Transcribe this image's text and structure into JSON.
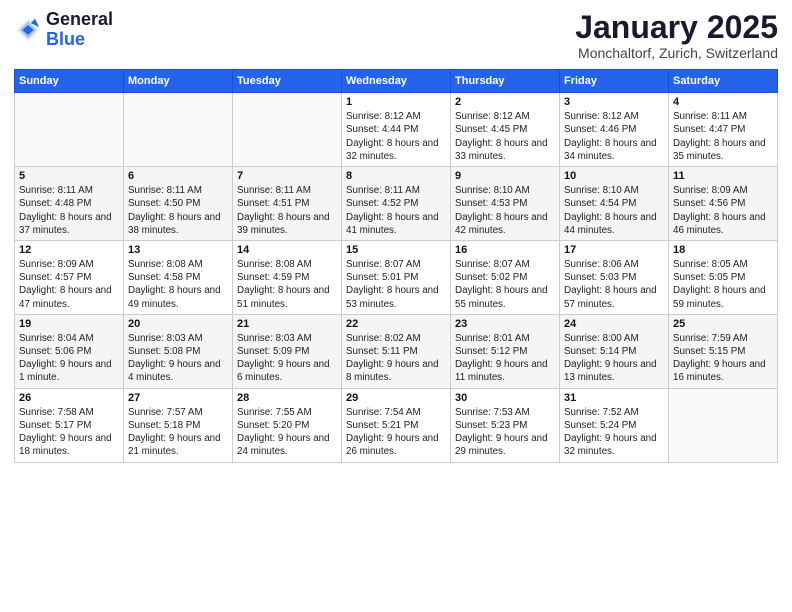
{
  "header": {
    "logo_general": "General",
    "logo_blue": "Blue",
    "month_title": "January 2025",
    "location": "Monchaltorf, Zurich, Switzerland"
  },
  "weekdays": [
    "Sunday",
    "Monday",
    "Tuesday",
    "Wednesday",
    "Thursday",
    "Friday",
    "Saturday"
  ],
  "weeks": [
    [
      {
        "day": "",
        "info": ""
      },
      {
        "day": "",
        "info": ""
      },
      {
        "day": "",
        "info": ""
      },
      {
        "day": "1",
        "info": "Sunrise: 8:12 AM\nSunset: 4:44 PM\nDaylight: 8 hours and 32 minutes."
      },
      {
        "day": "2",
        "info": "Sunrise: 8:12 AM\nSunset: 4:45 PM\nDaylight: 8 hours and 33 minutes."
      },
      {
        "day": "3",
        "info": "Sunrise: 8:12 AM\nSunset: 4:46 PM\nDaylight: 8 hours and 34 minutes."
      },
      {
        "day": "4",
        "info": "Sunrise: 8:11 AM\nSunset: 4:47 PM\nDaylight: 8 hours and 35 minutes."
      }
    ],
    [
      {
        "day": "5",
        "info": "Sunrise: 8:11 AM\nSunset: 4:48 PM\nDaylight: 8 hours and 37 minutes."
      },
      {
        "day": "6",
        "info": "Sunrise: 8:11 AM\nSunset: 4:50 PM\nDaylight: 8 hours and 38 minutes."
      },
      {
        "day": "7",
        "info": "Sunrise: 8:11 AM\nSunset: 4:51 PM\nDaylight: 8 hours and 39 minutes."
      },
      {
        "day": "8",
        "info": "Sunrise: 8:11 AM\nSunset: 4:52 PM\nDaylight: 8 hours and 41 minutes."
      },
      {
        "day": "9",
        "info": "Sunrise: 8:10 AM\nSunset: 4:53 PM\nDaylight: 8 hours and 42 minutes."
      },
      {
        "day": "10",
        "info": "Sunrise: 8:10 AM\nSunset: 4:54 PM\nDaylight: 8 hours and 44 minutes."
      },
      {
        "day": "11",
        "info": "Sunrise: 8:09 AM\nSunset: 4:56 PM\nDaylight: 8 hours and 46 minutes."
      }
    ],
    [
      {
        "day": "12",
        "info": "Sunrise: 8:09 AM\nSunset: 4:57 PM\nDaylight: 8 hours and 47 minutes."
      },
      {
        "day": "13",
        "info": "Sunrise: 8:08 AM\nSunset: 4:58 PM\nDaylight: 8 hours and 49 minutes."
      },
      {
        "day": "14",
        "info": "Sunrise: 8:08 AM\nSunset: 4:59 PM\nDaylight: 8 hours and 51 minutes."
      },
      {
        "day": "15",
        "info": "Sunrise: 8:07 AM\nSunset: 5:01 PM\nDaylight: 8 hours and 53 minutes."
      },
      {
        "day": "16",
        "info": "Sunrise: 8:07 AM\nSunset: 5:02 PM\nDaylight: 8 hours and 55 minutes."
      },
      {
        "day": "17",
        "info": "Sunrise: 8:06 AM\nSunset: 5:03 PM\nDaylight: 8 hours and 57 minutes."
      },
      {
        "day": "18",
        "info": "Sunrise: 8:05 AM\nSunset: 5:05 PM\nDaylight: 8 hours and 59 minutes."
      }
    ],
    [
      {
        "day": "19",
        "info": "Sunrise: 8:04 AM\nSunset: 5:06 PM\nDaylight: 9 hours and 1 minute."
      },
      {
        "day": "20",
        "info": "Sunrise: 8:03 AM\nSunset: 5:08 PM\nDaylight: 9 hours and 4 minutes."
      },
      {
        "day": "21",
        "info": "Sunrise: 8:03 AM\nSunset: 5:09 PM\nDaylight: 9 hours and 6 minutes."
      },
      {
        "day": "22",
        "info": "Sunrise: 8:02 AM\nSunset: 5:11 PM\nDaylight: 9 hours and 8 minutes."
      },
      {
        "day": "23",
        "info": "Sunrise: 8:01 AM\nSunset: 5:12 PM\nDaylight: 9 hours and 11 minutes."
      },
      {
        "day": "24",
        "info": "Sunrise: 8:00 AM\nSunset: 5:14 PM\nDaylight: 9 hours and 13 minutes."
      },
      {
        "day": "25",
        "info": "Sunrise: 7:59 AM\nSunset: 5:15 PM\nDaylight: 9 hours and 16 minutes."
      }
    ],
    [
      {
        "day": "26",
        "info": "Sunrise: 7:58 AM\nSunset: 5:17 PM\nDaylight: 9 hours and 18 minutes."
      },
      {
        "day": "27",
        "info": "Sunrise: 7:57 AM\nSunset: 5:18 PM\nDaylight: 9 hours and 21 minutes."
      },
      {
        "day": "28",
        "info": "Sunrise: 7:55 AM\nSunset: 5:20 PM\nDaylight: 9 hours and 24 minutes."
      },
      {
        "day": "29",
        "info": "Sunrise: 7:54 AM\nSunset: 5:21 PM\nDaylight: 9 hours and 26 minutes."
      },
      {
        "day": "30",
        "info": "Sunrise: 7:53 AM\nSunset: 5:23 PM\nDaylight: 9 hours and 29 minutes."
      },
      {
        "day": "31",
        "info": "Sunrise: 7:52 AM\nSunset: 5:24 PM\nDaylight: 9 hours and 32 minutes."
      },
      {
        "day": "",
        "info": ""
      }
    ]
  ]
}
